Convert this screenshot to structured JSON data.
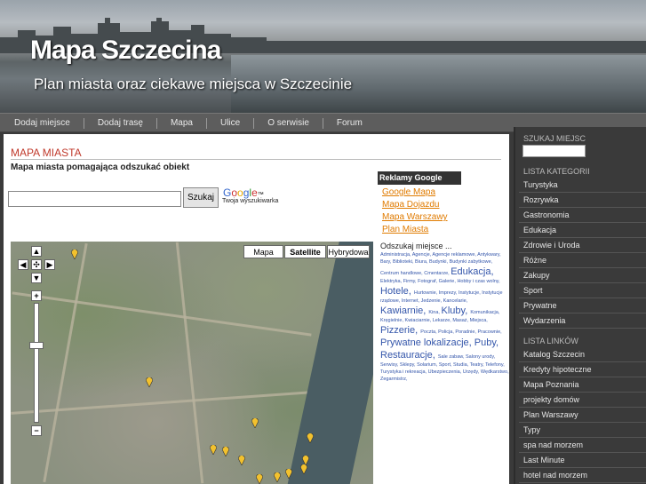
{
  "header": {
    "title": "Mapa Szczecina",
    "tagline": "Plan miasta oraz ciekawe miejsca w Szczecinie"
  },
  "nav": [
    "Dodaj miejsce",
    "Dodaj trasę",
    "Mapa",
    "Ulice",
    "O serwisie",
    "Forum"
  ],
  "main": {
    "section_title": "MAPA MIASTA",
    "subtitle": "Mapa miasta pomagająca odszukać obiekt"
  },
  "search": {
    "value": "",
    "button": "Szukaj",
    "google_logo": "Google™",
    "google_sub": "Twoja wyszukiwarka"
  },
  "ads": {
    "title": "Reklamy Google",
    "links": [
      "Google Mapa",
      "Mapa Dojazdu",
      "Mapa Warszawy",
      "Plan Miasta"
    ]
  },
  "map": {
    "types": [
      "Mapa",
      "Satellite",
      "Hybrydowa"
    ],
    "selected_type": "Satellite"
  },
  "keywords": {
    "label": "Odszukaj miejsce ...",
    "items": [
      [
        "Administracja",
        0
      ],
      [
        "Agencje",
        0
      ],
      [
        "Agencje reklamowe",
        0
      ],
      [
        "Antykwary",
        0
      ],
      [
        "Bary",
        0
      ],
      [
        "Biblioteki",
        0
      ],
      [
        "Biura",
        0
      ],
      [
        "Budynki",
        0
      ],
      [
        "Budynki zabytkowe",
        0
      ],
      [
        "Centrum handlowe",
        0
      ],
      [
        "Cmentarze",
        0
      ],
      [
        "Edukacja",
        1
      ],
      [
        "Elektryka",
        0
      ],
      [
        "Firmy",
        0
      ],
      [
        "Fotograf",
        0
      ],
      [
        "Galerie",
        0
      ],
      [
        "Hobby i czas wolny",
        0
      ],
      [
        "Hotele",
        1
      ],
      [
        "Hurtownie",
        0
      ],
      [
        "Imprezy",
        0
      ],
      [
        "Instytucje",
        0
      ],
      [
        "Instytucje rządowe",
        0
      ],
      [
        "Internet",
        0
      ],
      [
        "Jedzenie",
        0
      ],
      [
        "Kancelarie",
        0
      ],
      [
        "Kawiarnie",
        1
      ],
      [
        "Kina",
        0
      ],
      [
        "Kluby",
        1
      ],
      [
        "Komunikacja",
        0
      ],
      [
        "Kręgielnie",
        0
      ],
      [
        "Kwiaciarnie",
        0
      ],
      [
        "Lekarze",
        0
      ],
      [
        "Masaż",
        0
      ],
      [
        "Miejsca",
        0
      ],
      [
        "Pizzerie",
        1
      ],
      [
        "Poczta",
        0
      ],
      [
        "Policja",
        0
      ],
      [
        "Poradnie",
        0
      ],
      [
        "Pracownie",
        0
      ],
      [
        "Prywatne lokalizacje",
        1
      ],
      [
        "Puby",
        1
      ],
      [
        "Restauracje",
        1
      ],
      [
        "Sale zabaw",
        0
      ],
      [
        "Salony urody",
        0
      ],
      [
        "Serwisy",
        0
      ],
      [
        "Sklepy",
        0
      ],
      [
        "Solarium",
        0
      ],
      [
        "Sport",
        0
      ],
      [
        "Studia",
        0
      ],
      [
        "Teatry",
        0
      ],
      [
        "Telefony",
        0
      ],
      [
        "Turystyka i rekreacja",
        0
      ],
      [
        "Ubezpieczenia",
        0
      ],
      [
        "Urzędy",
        0
      ],
      [
        "Wędkarstwo",
        0
      ],
      [
        "Zegarmistrz",
        0
      ]
    ]
  },
  "sidebar": {
    "search_head": "SZUKAJ MIEJSC",
    "cat_head": "LISTA KATEGORII",
    "categories": [
      "Turystyka",
      "Rozrywka",
      "Gastronomia",
      "Edukacja",
      "Zdrowie i Uroda",
      "Różne",
      "Zakupy",
      "Sport",
      "Prywatne",
      "Wydarzenia"
    ],
    "links_head": "LISTA LINKÓW",
    "links": [
      "Katalog Szczecin",
      "Kredyty hipoteczne",
      "Mapa Poznania",
      "projekty domów",
      "Plan Warszawy",
      "Typy",
      "spa nad morzem",
      "Last Minute",
      "hotel nad morzem"
    ]
  },
  "colors": {
    "accent": "#c0392b",
    "ad_link": "#e07b00",
    "pin": "#f2c12e"
  }
}
